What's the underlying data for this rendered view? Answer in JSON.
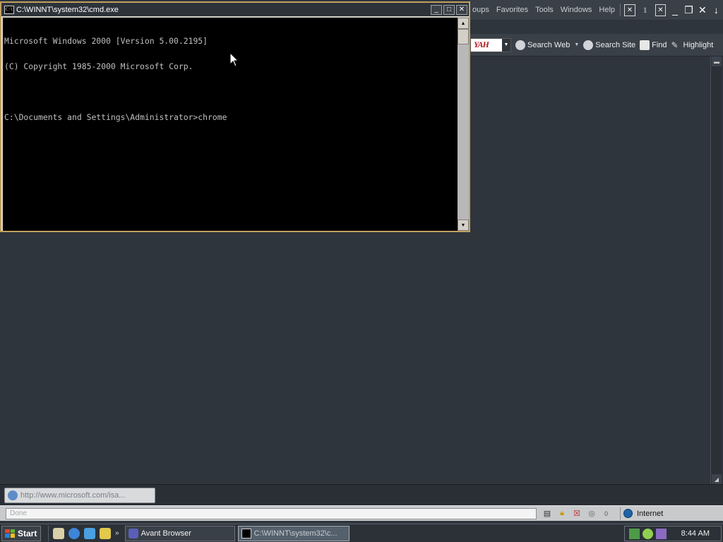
{
  "browser": {
    "menu": [
      "oups",
      "Favorites",
      "Tools",
      "Windows",
      "Help"
    ],
    "toolbar": {
      "search_engine_logo": "YAH",
      "search_web": "Search Web",
      "search_site": "Search Site",
      "find": "Find",
      "highlight": "Highlight"
    },
    "url_tab": "http://www.microsoft.com/isa...",
    "status": {
      "text": "Done",
      "popup_count": "0",
      "zone": "Internet"
    }
  },
  "cmd": {
    "title": "C:\\WINNT\\system32\\cmd.exe",
    "title_icon_text": "C:\\",
    "lines": [
      "Microsoft Windows 2000 [Version 5.00.2195]",
      "(C) Copyright 1985-2000 Microsoft Corp.",
      "",
      "C:\\Documents and Settings\\Administrator>chrome"
    ]
  },
  "taskbar": {
    "start_label": "Start",
    "tasks": [
      {
        "label": "Avant Browser"
      },
      {
        "label": "C:\\WINNT\\system32\\c..."
      }
    ],
    "clock": "8:44 AM"
  },
  "colors": {
    "desktop": "#2f353d",
    "cmd_border": "#c0a060",
    "ie_blue": "#1e63a8"
  }
}
